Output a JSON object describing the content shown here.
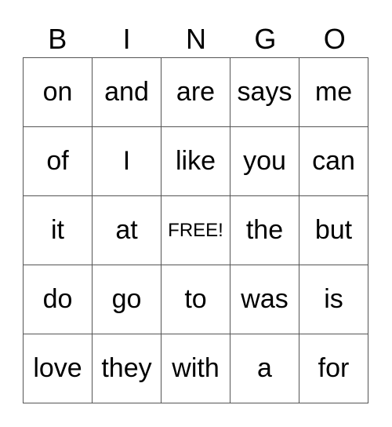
{
  "header": [
    "B",
    "I",
    "N",
    "G",
    "O"
  ],
  "grid": [
    [
      "on",
      "and",
      "are",
      "says",
      "me"
    ],
    [
      "of",
      "I",
      "like",
      "you",
      "can"
    ],
    [
      "it",
      "at",
      "FREE!",
      "the",
      "but"
    ],
    [
      "do",
      "go",
      "to",
      "was",
      "is"
    ],
    [
      "love",
      "they",
      "with",
      "a",
      "for"
    ]
  ]
}
